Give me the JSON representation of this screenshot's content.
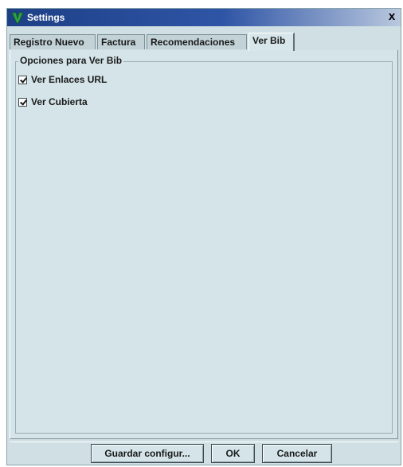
{
  "window": {
    "title": "Settings",
    "close_label": "x",
    "app_icon": "v-logo-icon"
  },
  "tabs": [
    {
      "label": "Registro Nuevo",
      "active": false
    },
    {
      "label": "Factura",
      "active": false
    },
    {
      "label": "Recomendaciones",
      "active": false
    },
    {
      "label": "Ver Bib",
      "active": true
    }
  ],
  "group": {
    "title": "Opciones para Ver Bib",
    "options": [
      {
        "label": "Ver Enlaces URL",
        "checked": true
      },
      {
        "label": "Ver Cubierta",
        "checked": true
      }
    ]
  },
  "buttons": {
    "save": "Guardar configur...",
    "ok": "OK",
    "cancel": "Cancelar"
  },
  "colors": {
    "titlebar": "#1d3f86",
    "panel": "#d4e4e8",
    "app_icon": "#2ea043"
  }
}
